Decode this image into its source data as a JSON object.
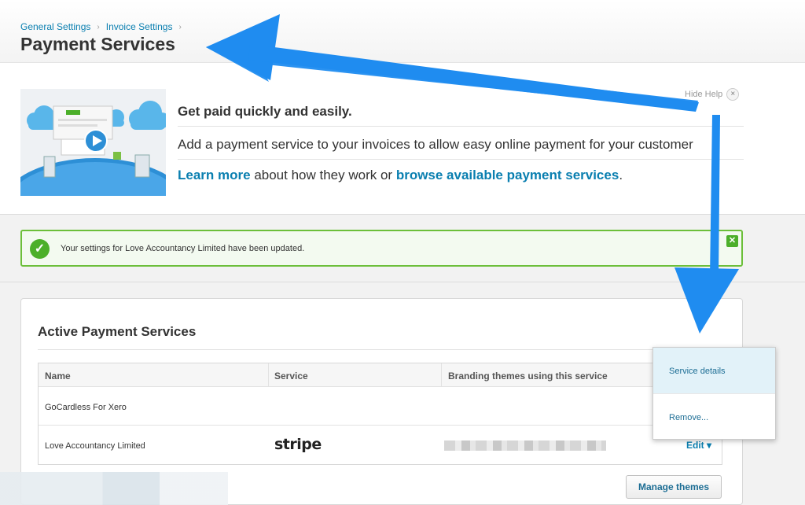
{
  "breadcrumb": {
    "general_settings": "General Settings",
    "invoice_settings": "Invoice Settings",
    "separator": "›"
  },
  "page_title": "Payment Services",
  "help": {
    "hide_label": "Hide Help",
    "hide_icon": "×",
    "heading": "Get paid quickly and easily.",
    "description": "Add a payment service to your invoices to allow easy online payment for your customer",
    "learn_more": "Learn more",
    "middle_text": " about how they work or ",
    "browse_link": "browse available payment services",
    "end_text": "."
  },
  "alert": {
    "check_icon": "✓",
    "message": "Your settings for Love Accountancy Limited have been updated.",
    "close_icon": "✕"
  },
  "active_services": {
    "title": "Active Payment Services",
    "columns": [
      "Name",
      "Service",
      "Branding themes using this service"
    ],
    "rows": [
      {
        "name": "GoCardless For Xero",
        "service": "",
        "themes": ""
      },
      {
        "name": "Love Accountancy Limited",
        "service": "stripe",
        "themes": "",
        "action": "Edit ▾"
      }
    ],
    "manage_button": "Manage themes"
  },
  "dropdown": {
    "items": [
      "Service details",
      "Remove..."
    ]
  },
  "colors": {
    "link": "#0a7fb0",
    "success": "#4caf2a",
    "annotation_arrow": "#1f8cf0"
  }
}
